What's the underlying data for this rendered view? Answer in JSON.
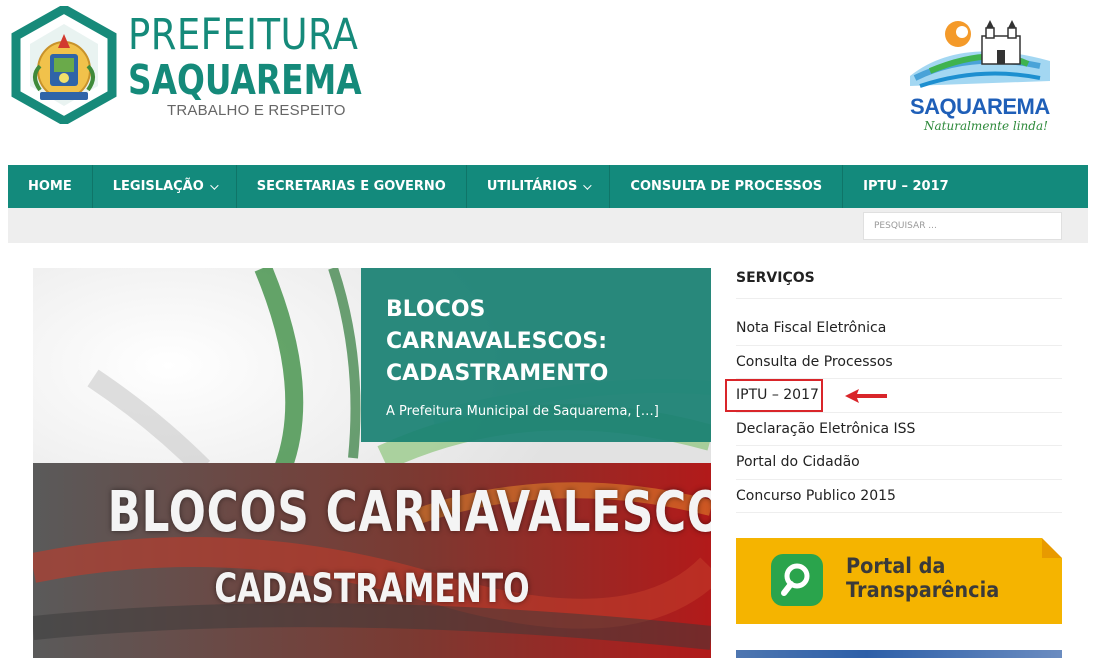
{
  "header": {
    "brand_line1": "PREFEITURA",
    "brand_line2": "SAQUAREMA",
    "brand_tagline": "TRABALHO E RESPEITO",
    "city_logo_name": "SAQUAREMA",
    "city_logo_slogan": "Naturalmente linda!"
  },
  "nav": {
    "items": [
      {
        "label": "HOME",
        "dropdown": false
      },
      {
        "label": "LEGISLAÇÃO",
        "dropdown": true
      },
      {
        "label": "SECRETARIAS E GOVERNO",
        "dropdown": false
      },
      {
        "label": "UTILITÁRIOS",
        "dropdown": true
      },
      {
        "label": "CONSULTA DE PROCESSOS",
        "dropdown": false
      },
      {
        "label": "IPTU – 2017",
        "dropdown": false
      }
    ],
    "search_placeholder": "PESQUISAR ..."
  },
  "featured": {
    "title": "BLOCOS CARNAVALESCOS: CADASTRAMENTO",
    "excerpt": "A Prefeitura Municipal de Saquarema, […]",
    "image_text_line1": "BLOCOS CARNAVALESCOS",
    "image_text_line2": "CADASTRAMENTO"
  },
  "sidebar": {
    "widget_title": "SERVIÇOS",
    "services": [
      {
        "label": "Nota Fiscal Eletrônica"
      },
      {
        "label": "Consulta de Processos"
      },
      {
        "label": "IPTU – 2017"
      },
      {
        "label": "Declaração Eletrônica ISS"
      },
      {
        "label": "Portal do Cidadão"
      },
      {
        "label": "Concurso Publico 2015"
      }
    ],
    "transparency_line1": "Portal da",
    "transparency_line2": "Transparência"
  },
  "colors": {
    "brand_teal": "#138a7c",
    "highlight_red": "#d9252a",
    "transparency_yellow": "#f5b400"
  }
}
